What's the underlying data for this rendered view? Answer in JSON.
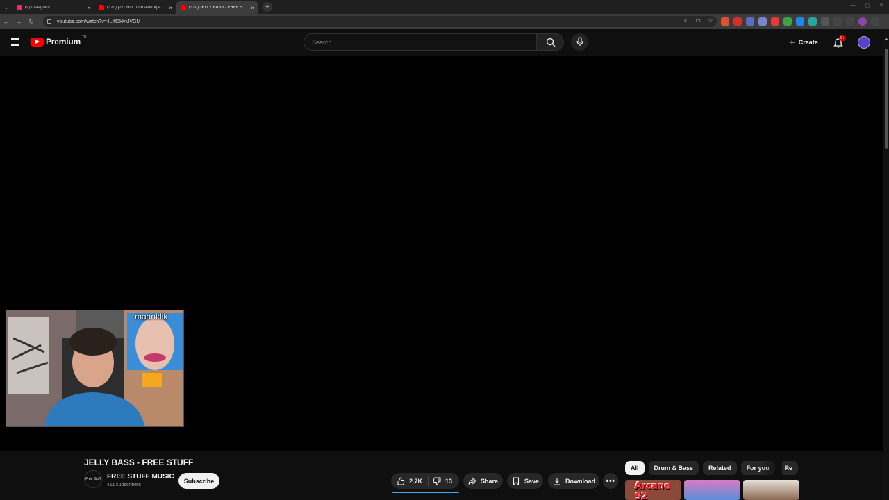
{
  "browser": {
    "tabs": [
      {
        "title": "(9) Instagram",
        "favicon_color": "#e1306c",
        "active": false
      },
      {
        "title": "(320) [27/39th Tournament] A ...",
        "favicon_color": "#ff0000",
        "active": false
      },
      {
        "title": "(320) JELLY BASS - FREE STUFF",
        "favicon_color": "#ff0000",
        "active": true
      }
    ],
    "url": "youtube.com/watch?v=4LjffDHvMVGM",
    "extension_colors": [
      "#e0532a",
      "#d32f2f",
      "#5c6bc0",
      "#7986cb",
      "#e53935",
      "#43a047",
      "#1e88e5",
      "#26a69a"
    ]
  },
  "header": {
    "logo_text": "Premium",
    "country_code": "TR",
    "search_placeholder": "Search",
    "create_label": "Create",
    "notifications_badge": "9+"
  },
  "player": {
    "webcam_overlay_name": "maanklik"
  },
  "video": {
    "title": "JELLY BASS - FREE STUFF",
    "channel_name": "FREE STUFF MUSIC",
    "channel_avatar_text": "Free Stuff",
    "subscribers": "411 subscribers",
    "subscribe_label": "Subscribe",
    "likes": "2.7K",
    "dislikes": "13",
    "share_label": "Share",
    "save_label": "Save",
    "download_label": "Download"
  },
  "chips": [
    "All",
    "Drum & Bass",
    "Related",
    "For you",
    "Re"
  ],
  "thumbnails": [
    {
      "text": "Arcane S2",
      "color": "#8a4a3a"
    },
    {
      "text": "",
      "color": "#c95bb0"
    },
    {
      "text": "",
      "color": "#b09a80"
    }
  ],
  "colors": {
    "accent": "#ff0000",
    "like_bar": "#3ea6ff",
    "badge": "#cc0000"
  }
}
